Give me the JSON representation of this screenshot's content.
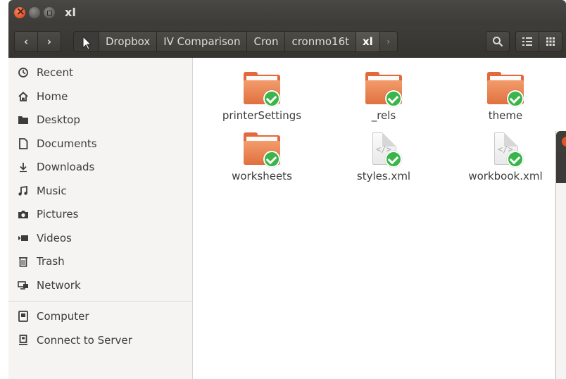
{
  "window": {
    "title": "xl"
  },
  "toolbar": {
    "back": "‹",
    "forward": "›",
    "breadcrumbs": [
      "Dropbox",
      "IV Comparison",
      "Cron",
      "cronmo16t",
      "xl"
    ],
    "more": "›"
  },
  "sidebar": {
    "items": [
      {
        "label": "Recent",
        "icon": "clock-icon"
      },
      {
        "label": "Home",
        "icon": "home-icon"
      },
      {
        "label": "Desktop",
        "icon": "folder-icon"
      },
      {
        "label": "Documents",
        "icon": "document-icon"
      },
      {
        "label": "Downloads",
        "icon": "download-icon"
      },
      {
        "label": "Music",
        "icon": "music-icon"
      },
      {
        "label": "Pictures",
        "icon": "camera-icon"
      },
      {
        "label": "Videos",
        "icon": "video-icon"
      },
      {
        "label": "Trash",
        "icon": "trash-icon"
      },
      {
        "label": "Network",
        "icon": "network-icon"
      }
    ],
    "devices": [
      {
        "label": "Computer",
        "icon": "computer-icon"
      },
      {
        "label": "Connect to Server",
        "icon": "server-icon"
      }
    ]
  },
  "files": [
    {
      "name": "printerSettings",
      "type": "folder",
      "synced": true
    },
    {
      "name": "_rels",
      "type": "folder",
      "synced": true
    },
    {
      "name": "theme",
      "type": "folder",
      "synced": true
    },
    {
      "name": "worksheets",
      "type": "folder",
      "synced": true
    },
    {
      "name": "styles.xml",
      "type": "xml",
      "synced": true
    },
    {
      "name": "workbook.xml",
      "type": "xml",
      "synced": true
    }
  ],
  "colors": {
    "folder": "#e3683c",
    "sync_check": "#3bb54a",
    "titlebar": "#3c3b37"
  }
}
